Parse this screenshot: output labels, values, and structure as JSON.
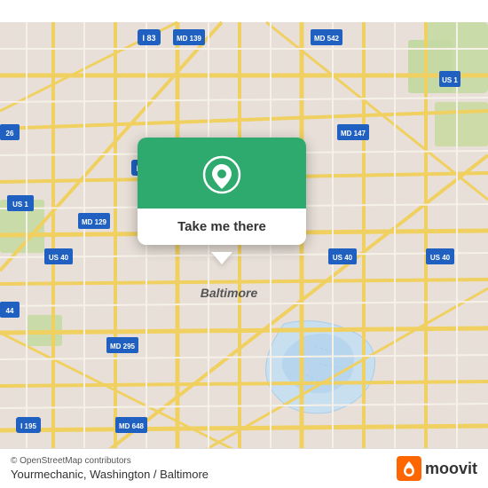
{
  "map": {
    "alt": "Baltimore map",
    "center": "Baltimore, MD"
  },
  "popup": {
    "button_label": "Take me there",
    "pin_icon": "location-pin"
  },
  "bottom_bar": {
    "attribution": "© OpenStreetMap contributors",
    "location_label": "Yourmechanic, Washington / Baltimore",
    "logo_text": "moovit"
  }
}
